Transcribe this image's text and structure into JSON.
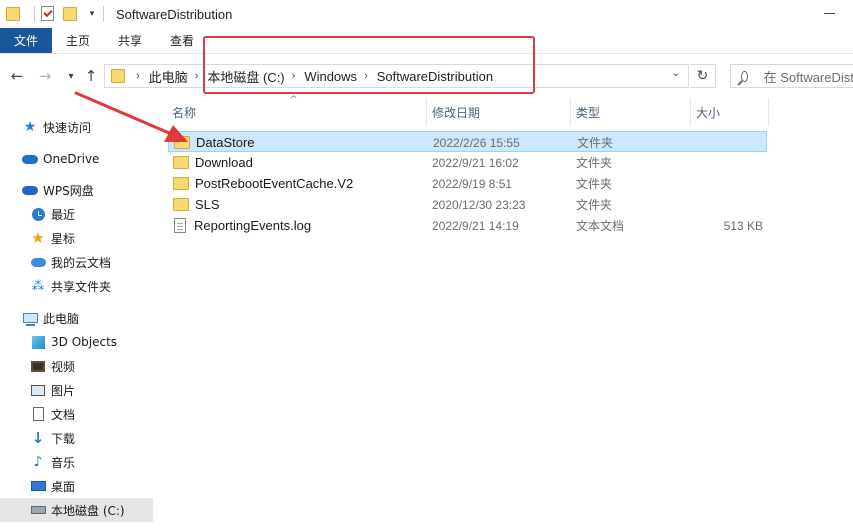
{
  "window": {
    "title": "SoftwareDistribution"
  },
  "ribbon": {
    "tabs": [
      "文件",
      "主页",
      "共享",
      "查看"
    ]
  },
  "address": {
    "crumbs": [
      "此电脑",
      "本地磁盘 (C:)",
      "Windows",
      "SoftwareDistribution"
    ]
  },
  "search": {
    "placeholder": "在 SoftwareDistribution 中搜索"
  },
  "sidebar": {
    "items": [
      {
        "label": "快速访问",
        "icon": "star-icon"
      },
      {
        "label": "OneDrive",
        "icon": "cloud-icon"
      },
      {
        "label": "WPS网盘",
        "icon": "wps-cloud-icon"
      },
      {
        "label": "最近",
        "icon": "clock-icon"
      },
      {
        "label": "星标",
        "icon": "star-filled-icon"
      },
      {
        "label": "我的云文档",
        "icon": "cloud-doc-icon"
      },
      {
        "label": "共享文件夹",
        "icon": "share-icon"
      },
      {
        "label": "此电脑",
        "icon": "computer-icon"
      },
      {
        "label": "3D Objects",
        "icon": "3d-objects-icon"
      },
      {
        "label": "视频",
        "icon": "video-icon"
      },
      {
        "label": "图片",
        "icon": "picture-icon"
      },
      {
        "label": "文档",
        "icon": "document-icon"
      },
      {
        "label": "下载",
        "icon": "download-icon"
      },
      {
        "label": "音乐",
        "icon": "music-icon"
      },
      {
        "label": "桌面",
        "icon": "desktop-icon"
      },
      {
        "label": "本地磁盘 (C:)",
        "icon": "drive-icon"
      }
    ]
  },
  "columns": {
    "name": "名称",
    "date": "修改日期",
    "type": "类型",
    "size": "大小"
  },
  "files": [
    {
      "name": "DataStore",
      "date": "2022/2/26 15:55",
      "type": "文件夹",
      "size": "",
      "kind": "folder"
    },
    {
      "name": "Download",
      "date": "2022/9/21 16:02",
      "type": "文件夹",
      "size": "",
      "kind": "folder"
    },
    {
      "name": "PostRebootEventCache.V2",
      "date": "2022/9/19 8:51",
      "type": "文件夹",
      "size": "",
      "kind": "folder"
    },
    {
      "name": "SLS",
      "date": "2020/12/30 23:23",
      "type": "文件夹",
      "size": "",
      "kind": "folder"
    },
    {
      "name": "ReportingEvents.log",
      "date": "2022/9/21 14:19",
      "type": "文本文档",
      "size": "513 KB",
      "kind": "file"
    }
  ],
  "colors": {
    "accent_file_tab": "#19579b",
    "selection": "#cce8ff",
    "annotation": "#e23a3a"
  }
}
